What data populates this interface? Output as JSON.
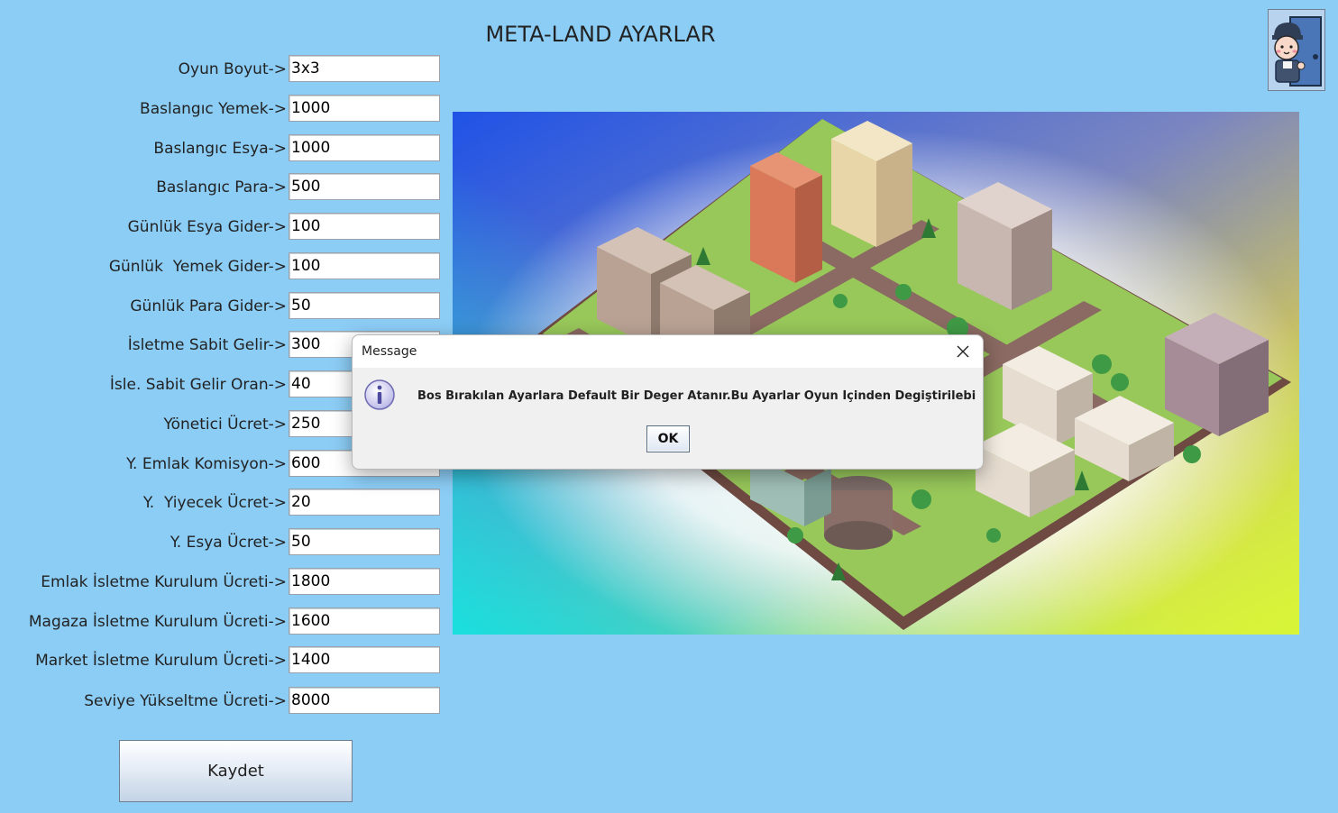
{
  "window": {
    "title": "META-LAND AYARLAR"
  },
  "colors": {
    "background": "#8ccdf6",
    "dialog": "#f0f0f0",
    "button_accent": "#c3d3e6"
  },
  "settings": [
    {
      "label": "Oyun Boyut->",
      "value": "3x3"
    },
    {
      "label": "Baslangıc Yemek->",
      "value": "1000"
    },
    {
      "label": "Baslangıc Esya->",
      "value": "1000"
    },
    {
      "label": "Baslangıc Para->",
      "value": "500"
    },
    {
      "label": "Günlük Esya Gider->",
      "value": "100"
    },
    {
      "label": "Günlük  Yemek Gider->",
      "value": "100"
    },
    {
      "label": "Günlük Para Gider->",
      "value": "50"
    },
    {
      "label": "İsletme Sabit Gelir->",
      "value": "300"
    },
    {
      "label": "İsle. Sabit Gelir Oran->",
      "value": "40"
    },
    {
      "label": "Yönetici Ücret->",
      "value": "250"
    },
    {
      "label": "Y. Emlak Komisyon->",
      "value": "600"
    },
    {
      "label": "Y.  Yiyecek Ücret->",
      "value": "20"
    },
    {
      "label": "Y. Esya Ücret->",
      "value": "50"
    },
    {
      "label": "Emlak İsletme Kurulum Ücreti->",
      "value": "1800"
    },
    {
      "label": "Magaza İsletme Kurulum Ücreti->",
      "value": "1600"
    },
    {
      "label": "Market İsletme Kurulum Ücreti->",
      "value": "1400"
    },
    {
      "label": "Seviye Yükseltme Ücreti->",
      "value": "8000"
    }
  ],
  "save_button": {
    "label": "Kaydet"
  },
  "profile": {
    "icon": "avatar-icon"
  },
  "illustration": {
    "icon": "isometric-city-image"
  },
  "dialog": {
    "title": "Message",
    "message": "Bos Bırakılan Ayarlara Default Bir Deger Atanır.Bu Ayarlar Oyun İçinden Degiştirilebilir...",
    "ok_label": "OK",
    "info_icon": "info-icon",
    "close_icon": "close-icon"
  }
}
